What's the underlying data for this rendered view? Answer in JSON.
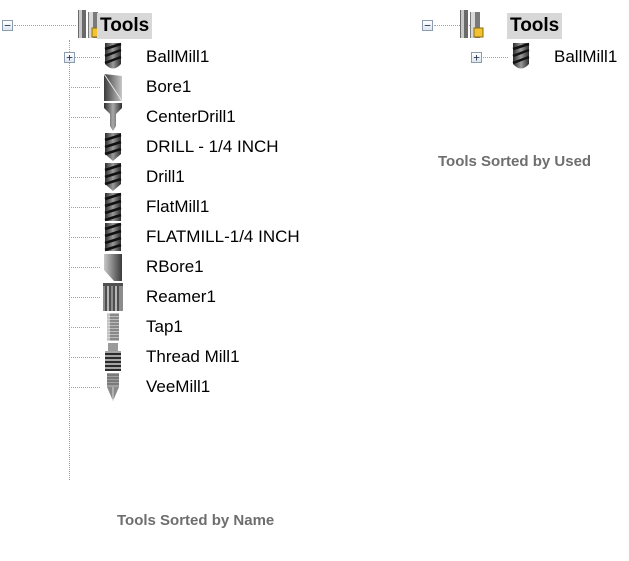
{
  "left_tree": {
    "root_label": "Tools",
    "root_expander": "⊟",
    "items": [
      {
        "label": "BallMill1",
        "icon": "ballmill-icon",
        "expander": "+"
      },
      {
        "label": "Bore1",
        "icon": "bore-icon"
      },
      {
        "label": "CenterDrill1",
        "icon": "centerdrill-icon"
      },
      {
        "label": "DRILL - 1/4 INCH",
        "icon": "drill-icon"
      },
      {
        "label": "Drill1",
        "icon": "drill-icon"
      },
      {
        "label": "FlatMill1",
        "icon": "flatmill-icon"
      },
      {
        "label": "FLATMILL-1/4 INCH",
        "icon": "flatmill-icon"
      },
      {
        "label": "RBore1",
        "icon": "rbore-icon"
      },
      {
        "label": "Reamer1",
        "icon": "reamer-icon"
      },
      {
        "label": "Tap1",
        "icon": "tap-icon"
      },
      {
        "label": "Thread Mill1",
        "icon": "threadmill-icon"
      },
      {
        "label": "VeeMill1",
        "icon": "veemill-icon"
      }
    ],
    "caption": "Tools Sorted by Name"
  },
  "right_tree": {
    "root_label": "Tools",
    "root_expander": "⊟",
    "items": [
      {
        "label": "BallMill1",
        "icon": "ballmill-icon",
        "expander": "+"
      }
    ],
    "caption": "Tools Sorted by Used"
  },
  "colors": {
    "selection_bg": "#d8d8d8",
    "caption": "#6e6e6e",
    "tree_lines": "#a0a0a0",
    "tool_steel_dark": "#3e3e3e",
    "tool_steel_light": "#b8b8b8"
  }
}
